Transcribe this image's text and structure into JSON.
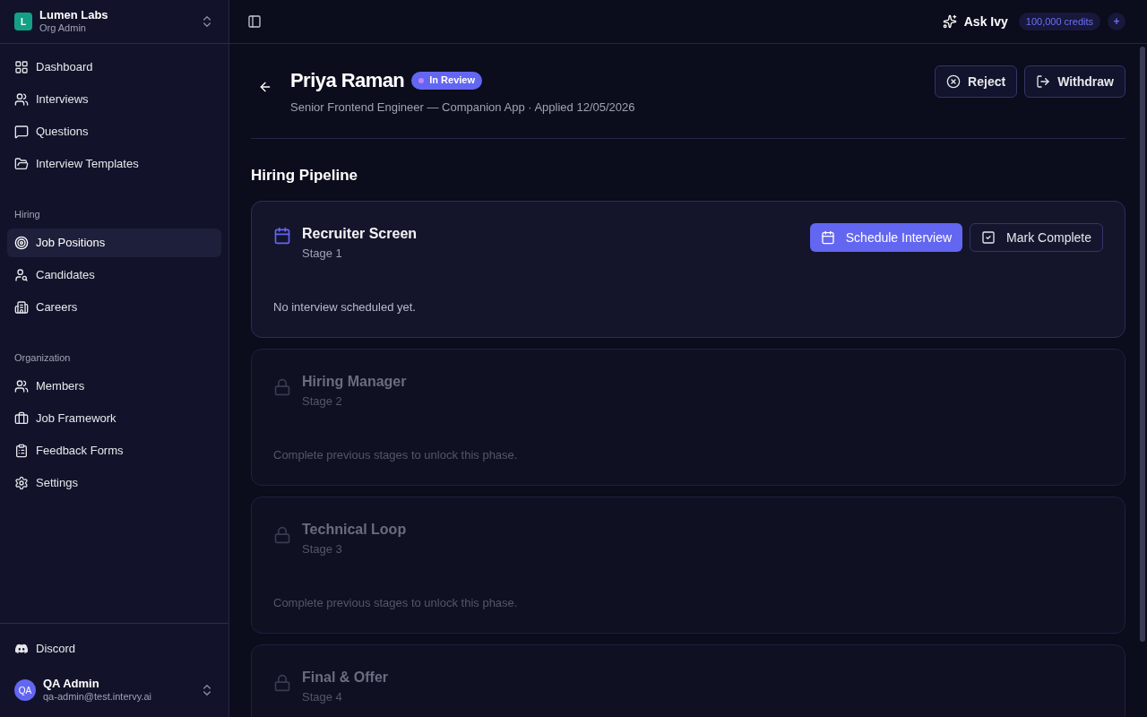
{
  "org": {
    "initial": "L",
    "name": "Lumen Labs",
    "role": "Org Admin"
  },
  "nav_sections": [
    {
      "items": [
        {
          "label": "Dashboard",
          "selected": false
        },
        {
          "label": "Interviews",
          "selected": false
        },
        {
          "label": "Questions",
          "selected": false
        },
        {
          "label": "Interview Templates",
          "selected": false
        }
      ]
    },
    {
      "heading": "Hiring",
      "items": [
        {
          "label": "Job Positions",
          "selected": true
        },
        {
          "label": "Candidates",
          "selected": false
        },
        {
          "label": "Careers",
          "selected": false
        }
      ]
    },
    {
      "heading": "Organization",
      "items": [
        {
          "label": "Members",
          "selected": false
        },
        {
          "label": "Job Framework",
          "selected": false
        },
        {
          "label": "Feedback Forms",
          "selected": false
        },
        {
          "label": "Settings",
          "selected": false
        }
      ]
    }
  ],
  "discord": "Discord",
  "user": {
    "initials": "QA",
    "name": "QA Admin",
    "email": "qa-admin@test.intervy.ai"
  },
  "topbar": {
    "ask": "Ask Ivy",
    "credits": "100,000 credits",
    "add": "+"
  },
  "candidate": {
    "name": "Priya Raman",
    "status": "In Review",
    "subtitle": "Senior Frontend Engineer — Companion App · Applied 12/05/2026"
  },
  "actions": [
    "Reject",
    "Withdraw"
  ],
  "pipeline_title": "Hiring Pipeline",
  "stages": [
    {
      "kind": "active",
      "title": "Recruiter Screen",
      "stage": "Stage 1",
      "buttons": [
        "Schedule Interview",
        "Mark Complete"
      ],
      "message": "No interview scheduled yet."
    },
    {
      "kind": "locked",
      "title": "Hiring Manager",
      "stage": "Stage 2",
      "message": "Complete previous stages to unlock this phase."
    },
    {
      "kind": "locked",
      "title": "Technical Loop",
      "stage": "Stage 3",
      "message": "Complete previous stages to unlock this phase."
    },
    {
      "kind": "locked",
      "title": "Final & Offer",
      "stage": "Stage 4"
    }
  ]
}
